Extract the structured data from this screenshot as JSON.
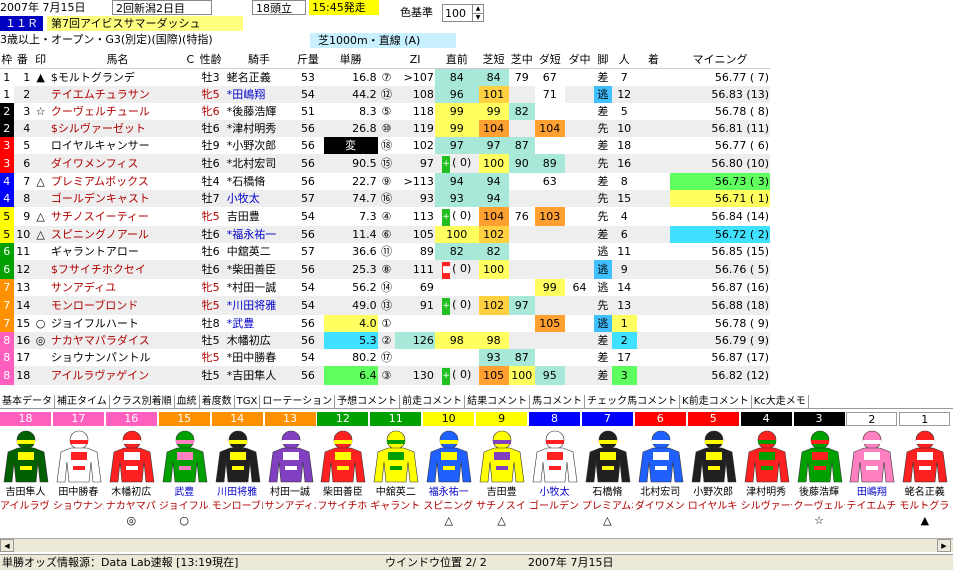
{
  "header": {
    "date": "2007年 7月15日",
    "venue": "2回新潟2日目",
    "heads": "18頭立",
    "start": "15:45発走",
    "race_no": "１１Ｒ",
    "race_name": "第7回アイビスサマーダッシュ",
    "conditions": "3歳以上・オープン・G3(別定)(国際)(特指)",
    "course": "芝1000m・直線 (A)",
    "color_label": "色基準",
    "color_value": "100"
  },
  "columns": [
    "枠",
    "番",
    "印",
    "馬名",
    "C",
    "性齢",
    "騎手",
    "斤量",
    "単勝",
    "",
    "ZI",
    "直前",
    "芝短",
    "芝中",
    "ダ短",
    "ダ中",
    "脚",
    "人",
    "着",
    "マイニング"
  ],
  "rows": [
    {
      "waku": "1",
      "wc": "#ffffff",
      "wt": "#000",
      "ban": "1",
      "mark": "▲",
      "name": "$モルトグランデ",
      "nc": "black",
      "sex": "牡3",
      "jk": "蛯名正義",
      "jc": "black",
      "wt_kg": "53",
      "odds": "16.8",
      "rank": "⑦",
      "zi": ">107",
      "zf": "",
      "zfc": "",
      "pre": "84",
      "pc": "#a8e8d8",
      "s1": "84",
      "s1c": "#a8e8d8",
      "s2": "79",
      "s2c": "",
      "d1": "67",
      "d1c": "",
      "d2": "",
      "d2c": "",
      "ky": "差",
      "kc": "",
      "pop": "7",
      "popc": "",
      "fin": "",
      "mi": "56.77",
      "mir": "( 7)",
      "mic": ""
    },
    {
      "waku": "1",
      "wc": "#ffffff",
      "wt": "#000",
      "ban": "2",
      "mark": "",
      "name": "テイエムチュラサン",
      "nc": "red",
      "sex": "牝5",
      "jk": "*田嶋翔",
      "jc": "blue",
      "wt_kg": "54",
      "odds": "44.2",
      "rank": "⑫",
      "zi": "108",
      "zf": "",
      "zfc": "",
      "pre": "96",
      "pc": "#a8e8d8",
      "s1": "101",
      "s1c": "#ffd040",
      "s2": "",
      "s2c": "",
      "d1": "71",
      "d1c": "#fff",
      "d2": "",
      "d2c": "",
      "ky": "逃",
      "kc": "#40c0ff",
      "pop": "12",
      "popc": "",
      "fin": "",
      "mi": "56.83",
      "mir": "(13)",
      "mic": ""
    },
    {
      "waku": "2",
      "wc": "#000000",
      "wt": "#fff",
      "ban": "3",
      "mark": "☆",
      "name": "クーヴェルチュール",
      "nc": "red",
      "sex": "牝6",
      "jk": "*後藤浩輝",
      "jc": "black",
      "wt_kg": "51",
      "odds": "8.3",
      "rank": "⑤",
      "zi": "118",
      "zf": "",
      "zfc": "",
      "pre": "99",
      "pc": "#ffff60",
      "s1": "99",
      "s1c": "#ffff60",
      "s2": "82",
      "s2c": "#a8e8d8",
      "d1": "",
      "d1c": "",
      "d2": "",
      "d2c": "",
      "ky": "差",
      "kc": "",
      "pop": "5",
      "popc": "",
      "fin": "",
      "mi": "56.78",
      "mir": "( 8)",
      "mic": ""
    },
    {
      "waku": "2",
      "wc": "#000000",
      "wt": "#fff",
      "ban": "4",
      "mark": "",
      "name": "$シルヴァーゼット",
      "nc": "red",
      "sex": "牡6",
      "jk": "*津村明秀",
      "jc": "black",
      "wt_kg": "56",
      "odds": "26.8",
      "rank": "⑩",
      "zi": "119",
      "zf": "",
      "zfc": "",
      "pre": "99",
      "pc": "#ffff60",
      "s1": "104",
      "s1c": "#ffa030",
      "s2": "",
      "s2c": "",
      "d1": "104",
      "d1c": "#ffa030",
      "d2": "",
      "d2c": "",
      "ky": "先",
      "kc": "",
      "pop": "10",
      "popc": "",
      "fin": "",
      "mi": "56.81",
      "mir": "(11)",
      "mic": ""
    },
    {
      "waku": "3",
      "wc": "#ff0000",
      "wt": "#fff",
      "ban": "5",
      "mark": "",
      "name": "ロイヤルキャンサー",
      "nc": "black",
      "sex": "牡9",
      "jk": "*小野次郎",
      "jc": "black",
      "wt_kg": "56",
      "odds": "変",
      "rank": "⑱",
      "zi": "102",
      "zf": "",
      "zfc": "",
      "pre": "97",
      "pc": "#a8e8d8",
      "s1": "97",
      "s1c": "#a8e8d8",
      "s2": "87",
      "s2c": "#a8e8d8",
      "d1": "",
      "d1c": "",
      "d2": "",
      "d2c": "",
      "ky": "差",
      "kc": "",
      "pop": "18",
      "popc": "",
      "fin": "",
      "mi": "56.77",
      "mir": "( 6)",
      "mic": ""
    },
    {
      "waku": "3",
      "wc": "#ff0000",
      "wt": "#fff",
      "ban": "6",
      "mark": "",
      "name": "ダイワメンフィス",
      "nc": "red",
      "sex": "牡6",
      "jk": "*北村宏司",
      "jc": "black",
      "wt_kg": "56",
      "odds": "90.5",
      "rank": "⑮",
      "zi": "97",
      "zf": "+",
      "zfc": "#20c020",
      "pre": "(  0)",
      "pc": "",
      "s1": "100",
      "s1c": "#ffff60",
      "s2": "90",
      "s2c": "#a8e8d8",
      "d1": "89",
      "d1c": "#a8e8d8",
      "d2": "",
      "d2c": "",
      "ky": "先",
      "kc": "",
      "pop": "16",
      "popc": "",
      "fin": "",
      "mi": "56.80",
      "mir": "(10)",
      "mic": ""
    },
    {
      "waku": "4",
      "wc": "#0000ff",
      "wt": "#fff",
      "ban": "7",
      "mark": "△",
      "name": "プレミアムボックス",
      "nc": "red",
      "sex": "牡4",
      "jk": "*石橋脩",
      "jc": "black",
      "wt_kg": "56",
      "odds": "22.7",
      "rank": "⑨",
      "zi": ">113",
      "zf": "",
      "zfc": "",
      "pre": "94",
      "pc": "#a8e8d8",
      "s1": "94",
      "s1c": "#a8e8d8",
      "s2": "",
      "s2c": "",
      "d1": "63",
      "d1c": "",
      "d2": "",
      "d2c": "",
      "ky": "差",
      "kc": "",
      "pop": "8",
      "popc": "",
      "fin": "",
      "mi": "56.73",
      "mir": "( 3)",
      "mic": "#60ff60"
    },
    {
      "waku": "4",
      "wc": "#0000ff",
      "wt": "#fff",
      "ban": "8",
      "mark": "",
      "name": "ゴールデンキャスト",
      "nc": "red",
      "sex": "牡7",
      "jk": "小牧太",
      "jc": "blue",
      "wt_kg": "57",
      "odds": "74.7",
      "rank": "⑯",
      "zi": "93",
      "zf": "",
      "zfc": "",
      "pre": "93",
      "pc": "#a8e8d8",
      "s1": "94",
      "s1c": "#a8e8d8",
      "s2": "",
      "s2c": "",
      "d1": "",
      "d1c": "",
      "d2": "",
      "d2c": "",
      "ky": "先",
      "kc": "",
      "pop": "15",
      "popc": "",
      "fin": "",
      "mi": "56.71",
      "mir": "( 1)",
      "mic": "#ffff60"
    },
    {
      "waku": "5",
      "wc": "#ffff00",
      "wt": "#000",
      "ban": "9",
      "mark": "△",
      "name": "サチノスイーティー",
      "nc": "red",
      "sex": "牝5",
      "jk": "吉田豊",
      "jc": "black",
      "wt_kg": "54",
      "odds": "7.3",
      "rank": "④",
      "zi": "113",
      "zf": "+",
      "zfc": "#20c020",
      "pre": "(  0)",
      "pc": "",
      "s1": "104",
      "s1c": "#ffa030",
      "s2": "76",
      "s2c": "",
      "d1": "103",
      "d1c": "#ffa030",
      "d2": "",
      "d2c": "",
      "ky": "先",
      "kc": "",
      "pop": "4",
      "popc": "",
      "fin": "",
      "mi": "56.84",
      "mir": "(14)",
      "mic": ""
    },
    {
      "waku": "5",
      "wc": "#ffff00",
      "wt": "#000",
      "ban": "10",
      "mark": "△",
      "name": "スピニングノアール",
      "nc": "red",
      "sex": "牡6",
      "jk": "*福永祐一",
      "jc": "blue",
      "wt_kg": "56",
      "odds": "11.4",
      "rank": "⑥",
      "zi": "105",
      "zf": "",
      "zfc": "",
      "pre": "100",
      "pc": "#ffff60",
      "s1": "102",
      "s1c": "#ffd040",
      "s2": "",
      "s2c": "",
      "d1": "",
      "d1c": "",
      "d2": "",
      "d2c": "",
      "ky": "差",
      "kc": "",
      "pop": "6",
      "popc": "",
      "fin": "",
      "mi": "56.72",
      "mir": "( 2)",
      "mic": "#40e0ff"
    },
    {
      "waku": "6",
      "wc": "#00a000",
      "wt": "#fff",
      "ban": "11",
      "mark": "",
      "name": "ギャラントアロー",
      "nc": "black",
      "sex": "牡6",
      "jk": "中舘英二",
      "jc": "black",
      "wt_kg": "57",
      "odds": "36.6",
      "rank": "⑪",
      "zi": "89",
      "zf": "",
      "zfc": "",
      "pre": "82",
      "pc": "#a8e8d8",
      "s1": "82",
      "s1c": "#a8e8d8",
      "s2": "",
      "s2c": "",
      "d1": "",
      "d1c": "",
      "d2": "",
      "d2c": "",
      "ky": "逃",
      "kc": "",
      "pop": "11",
      "popc": "",
      "fin": "",
      "mi": "56.85",
      "mir": "(15)",
      "mic": ""
    },
    {
      "waku": "6",
      "wc": "#00a000",
      "wt": "#fff",
      "ban": "12",
      "mark": "",
      "name": "$フサイチホクセイ",
      "nc": "red",
      "sex": "牡6",
      "jk": "*柴田善臣",
      "jc": "black",
      "wt_kg": "56",
      "odds": "25.3",
      "rank": "⑧",
      "zi": "111",
      "zf": "■",
      "zfc": "#ff2020",
      "pre": "(  0)",
      "pc": "",
      "s1": "100",
      "s1c": "#ffff60",
      "s2": "",
      "s2c": "",
      "d1": "",
      "d1c": "",
      "d2": "",
      "d2c": "",
      "ky": "逃",
      "kc": "#40c0ff",
      "pop": "9",
      "popc": "",
      "fin": "",
      "mi": "56.76",
      "mir": "( 5)",
      "mic": ""
    },
    {
      "waku": "7",
      "wc": "#ff9000",
      "wt": "#fff",
      "ban": "13",
      "mark": "",
      "name": "サンアディユ",
      "nc": "red",
      "sex": "牝5",
      "jk": "*村田一誠",
      "jc": "black",
      "wt_kg": "54",
      "odds": "56.2",
      "rank": "⑭",
      "zi": "69",
      "zf": "",
      "zfc": "",
      "pre": "",
      "pc": "",
      "s1": "",
      "s1c": "",
      "s2": "",
      "s2c": "",
      "d1": "99",
      "d1c": "#ffff60",
      "d2": "64",
      "d2c": "",
      "ky": "逃",
      "kc": "",
      "pop": "14",
      "popc": "",
      "fin": "",
      "mi": "56.87",
      "mir": "(16)",
      "mic": ""
    },
    {
      "waku": "7",
      "wc": "#ff9000",
      "wt": "#fff",
      "ban": "14",
      "mark": "",
      "name": "モンローブロンド",
      "nc": "red",
      "sex": "牝5",
      "jk": "*川田将雅",
      "jc": "blue",
      "wt_kg": "54",
      "odds": "49.0",
      "rank": "⑬",
      "zi": "91",
      "zf": "+",
      "zfc": "#20c020",
      "pre": "(  0)",
      "pc": "",
      "s1": "102",
      "s1c": "#ffd040",
      "s2": "97",
      "s2c": "#a8e8d8",
      "d1": "",
      "d1c": "",
      "d2": "",
      "d2c": "",
      "ky": "先",
      "kc": "",
      "pop": "13",
      "popc": "",
      "fin": "",
      "mi": "56.88",
      "mir": "(18)",
      "mic": ""
    },
    {
      "waku": "7",
      "wc": "#ff9000",
      "wt": "#fff",
      "ban": "15",
      "mark": "○",
      "name": "ジョイフルハート",
      "nc": "black",
      "sex": "牡8",
      "jk": "*武豊",
      "jc": "blue",
      "wt_kg": "56",
      "odds": "4.0",
      "rank": "①",
      "zi": "",
      "zf": "",
      "zfc": "",
      "pre": "",
      "pc": "",
      "s1": "",
      "s1c": "",
      "s2": "",
      "s2c": "",
      "d1": "105",
      "d1c": "#ffa030",
      "d2": "",
      "d2c": "",
      "ky": "逃",
      "kc": "#40c0ff",
      "pop": "1",
      "popc": "#ffff60",
      "fin": "",
      "mi": "56.78",
      "mir": "( 9)",
      "mic": ""
    },
    {
      "waku": "8",
      "wc": "#ff60c0",
      "wt": "#fff",
      "ban": "16",
      "mark": "◎",
      "name": "ナカヤマパラダイス",
      "nc": "red",
      "sex": "牡5",
      "jk": "木幡初広",
      "jc": "black",
      "wt_kg": "56",
      "odds": "5.3",
      "rank": "②",
      "zi": "126",
      "zf": "",
      "zfc": "",
      "pre": "98",
      "pc": "#ffff60",
      "s1": "98",
      "s1c": "#ffff60",
      "s2": "",
      "s2c": "",
      "d1": "",
      "d1c": "",
      "d2": "",
      "d2c": "",
      "ky": "差",
      "kc": "",
      "pop": "2",
      "popc": "#40e0ff",
      "fin": "",
      "mi": "56.79",
      "mir": "( 9)",
      "mic": ""
    },
    {
      "waku": "8",
      "wc": "#ff60c0",
      "wt": "#fff",
      "ban": "17",
      "mark": "",
      "name": "ショウナンパントル",
      "nc": "black",
      "sex": "牝5",
      "jk": "*田中勝春",
      "jc": "black",
      "wt_kg": "54",
      "odds": "80.2",
      "rank": "⑰",
      "zi": "",
      "zf": "",
      "zfc": "",
      "pre": "",
      "pc": "",
      "s1": "93",
      "s1c": "#a8e8d8",
      "s2": "87",
      "s2c": "#a8e8d8",
      "d1": "",
      "d1c": "",
      "d2": "",
      "d2c": "",
      "ky": "差",
      "kc": "",
      "pop": "17",
      "popc": "",
      "fin": "",
      "mi": "56.87",
      "mir": "(17)",
      "mic": ""
    },
    {
      "waku": "8",
      "wc": "#ff60c0",
      "wt": "#fff",
      "ban": "18",
      "mark": "",
      "name": "アイルラヴァゲイン",
      "nc": "red",
      "sex": "牡5",
      "jk": "*吉田隼人",
      "jc": "black",
      "wt_kg": "56",
      "odds": "6.4",
      "rank": "③",
      "zi": "130",
      "zf": "+",
      "zfc": "#20c020",
      "pre": "(  0)",
      "pc": "",
      "s1": "105",
      "s1c": "#ffa030",
      "s2": "100",
      "s2c": "#ffff60",
      "d1": "95",
      "d1c": "#a8e8d8",
      "d2": "",
      "d2c": "",
      "ky": "差",
      "kc": "",
      "pop": "3",
      "popc": "#60ff60",
      "fin": "",
      "mi": "56.82",
      "mir": "(12)",
      "mic": ""
    }
  ],
  "tabs": [
    "基本データ",
    "補正タイム",
    "クラス別着順",
    "血統",
    "着度数",
    "TGX",
    "ローテーション",
    "予想コメント",
    "前走コメント",
    "結果コメント",
    "馬コメント",
    "チェック馬コメント",
    "K前走コメント",
    "Kc大走メモ"
  ],
  "silks": [
    {
      "num": "18",
      "bg": "#ff60c0",
      "jk": "吉田隼人",
      "jc": "black",
      "hn": "アイルラヴァ",
      "mk": "",
      "c1": "#006000",
      "c2": "#ffff00"
    },
    {
      "num": "17",
      "bg": "#ff60c0",
      "jk": "田中勝春",
      "jc": "black",
      "hn": "ショウナンパ",
      "mk": "",
      "c1": "#ffffff",
      "c2": "#ff2020"
    },
    {
      "num": "16",
      "bg": "#ff60c0",
      "jk": "木幡初広",
      "jc": "black",
      "hn": "ナカヤマパラ",
      "mk": "◎",
      "c1": "#ff2020",
      "c2": "#ffffff"
    },
    {
      "num": "15",
      "bg": "#ff9000",
      "jk": "武豊",
      "jc": "blue",
      "hn": "ジョイフルハ",
      "mk": "○",
      "c1": "#00a000",
      "c2": "#ff80c0"
    },
    {
      "num": "14",
      "bg": "#ff9000",
      "jk": "川田将雅",
      "jc": "blue",
      "hn": "モンローブロ",
      "mk": "",
      "c1": "#202020",
      "c2": "#ffff00"
    },
    {
      "num": "13",
      "bg": "#ff9000",
      "jk": "村田一誠",
      "jc": "black",
      "hn": "サンアディユ",
      "mk": "",
      "c1": "#8040c0",
      "c2": "#ffffff"
    },
    {
      "num": "12",
      "bg": "#00a000",
      "jk": "柴田善臣",
      "jc": "black",
      "hn": "フサイチホク",
      "mk": "",
      "c1": "#ff2020",
      "c2": "#ffff00"
    },
    {
      "num": "11",
      "bg": "#00a000",
      "jk": "中舘英二",
      "jc": "black",
      "hn": "ギャラントア",
      "mk": "",
      "c1": "#ffff00",
      "c2": "#00a000"
    },
    {
      "num": "10",
      "bg": "#ffff00",
      "jk": "福永祐一",
      "jc": "blue",
      "hn": "スピニングノ",
      "mk": "△",
      "c1": "#2060ff",
      "c2": "#ffff00"
    },
    {
      "num": "9",
      "bg": "#ffff00",
      "jk": "吉田豊",
      "jc": "black",
      "hn": "サチノスイー",
      "mk": "△",
      "c1": "#ffff00",
      "c2": "#8040c0"
    },
    {
      "num": "8",
      "bg": "#0000ff",
      "jk": "小牧太",
      "jc": "blue",
      "hn": "ゴールデンキ",
      "mk": "",
      "c1": "#ffffff",
      "c2": "#ff2020"
    },
    {
      "num": "7",
      "bg": "#0000ff",
      "jk": "石橋脩",
      "jc": "black",
      "hn": "プレミアムボ",
      "mk": "△",
      "c1": "#202020",
      "c2": "#ffff00"
    },
    {
      "num": "6",
      "bg": "#ff0000",
      "jk": "北村宏司",
      "jc": "black",
      "hn": "ダイワメンフ",
      "mk": "",
      "c1": "#2060ff",
      "c2": "#ffffff"
    },
    {
      "num": "5",
      "bg": "#ff0000",
      "jk": "小野次郎",
      "jc": "black",
      "hn": "ロイヤルキャ",
      "mk": "",
      "c1": "#202020",
      "c2": "#ffff00"
    },
    {
      "num": "4",
      "bg": "#000000",
      "jk": "津村明秀",
      "jc": "black",
      "hn": "シルヴァーゼ",
      "mk": "",
      "c1": "#ff2020",
      "c2": "#00a000"
    },
    {
      "num": "3",
      "bg": "#000000",
      "jk": "後藤浩輝",
      "jc": "black",
      "hn": "クーヴェルチ",
      "mk": "☆",
      "c1": "#00a000",
      "c2": "#ff2020"
    },
    {
      "num": "2",
      "bg": "#ffffff",
      "jk": "田嶋翔",
      "jc": "blue",
      "hn": "テイエムチュ",
      "mk": "",
      "c1": "#ff80c0",
      "c2": "#ffffff"
    },
    {
      "num": "1",
      "bg": "#ffffff",
      "jk": "蛯名正義",
      "jc": "black",
      "hn": "モルトグラン",
      "mk": "▲",
      "c1": "#ff2020",
      "c2": "#ffffff"
    }
  ],
  "status": {
    "source": "単勝オッズ情報源：Data Lab速報 [13:19現在]",
    "window": "ウインドウ位置 2/ 2",
    "date": "2007年 7月15日"
  }
}
